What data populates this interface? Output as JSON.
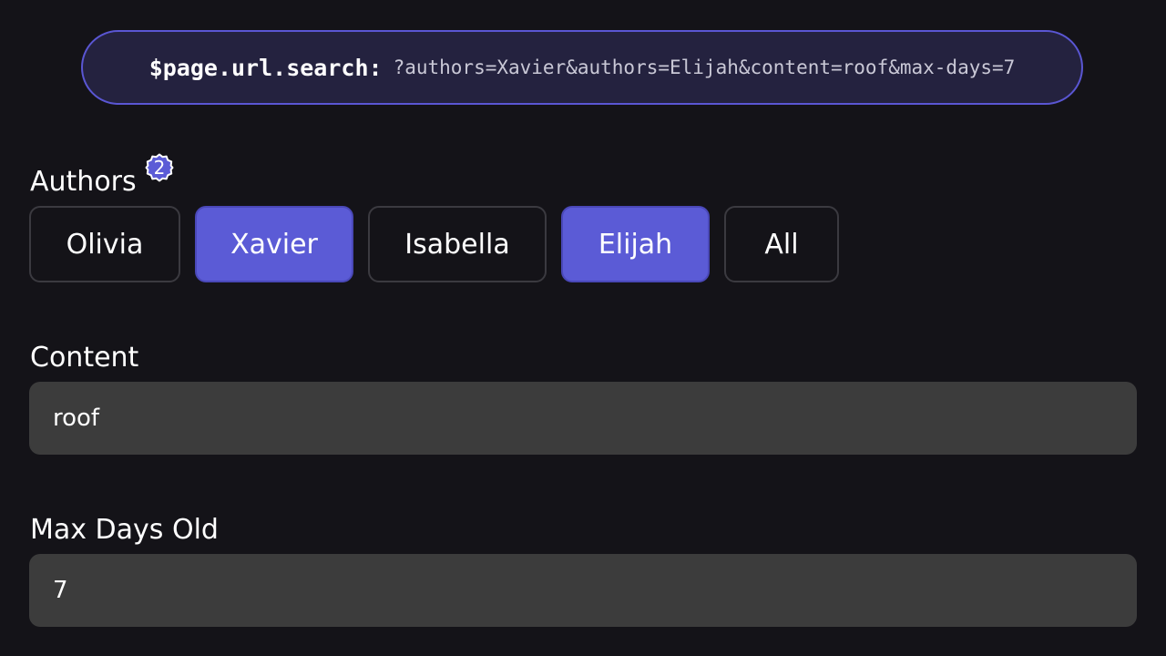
{
  "url_bar": {
    "key": "$page.url.search:",
    "value": "?authors=Xavier&authors=Elijah&content=roof&max-days=7"
  },
  "authors": {
    "label": "Authors",
    "selected_count": "2",
    "options": [
      {
        "label": "Olivia",
        "selected": false
      },
      {
        "label": "Xavier",
        "selected": true
      },
      {
        "label": "Isabella",
        "selected": false
      },
      {
        "label": "Elijah",
        "selected": true
      },
      {
        "label": "All",
        "selected": false
      }
    ]
  },
  "content": {
    "label": "Content",
    "value": "roof"
  },
  "max_days": {
    "label": "Max Days Old",
    "value": "7"
  },
  "colors": {
    "background": "#141318",
    "accent": "#5b5bd6",
    "pill_background": "#24223f",
    "input_background": "#3c3c3c"
  }
}
